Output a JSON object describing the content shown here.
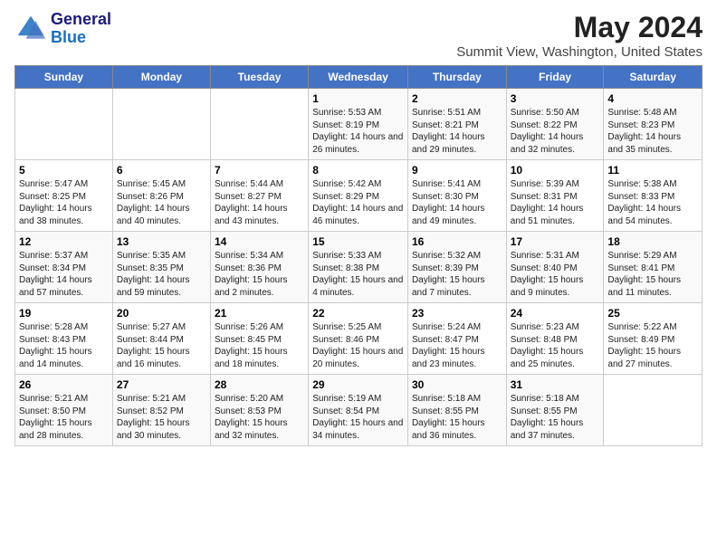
{
  "logo": {
    "line1": "General",
    "line2": "Blue"
  },
  "title": "May 2024",
  "subtitle": "Summit View, Washington, United States",
  "days_of_week": [
    "Sunday",
    "Monday",
    "Tuesday",
    "Wednesday",
    "Thursday",
    "Friday",
    "Saturday"
  ],
  "weeks": [
    [
      {
        "day": "",
        "info": ""
      },
      {
        "day": "",
        "info": ""
      },
      {
        "day": "",
        "info": ""
      },
      {
        "day": "1",
        "info": "Sunrise: 5:53 AM\nSunset: 8:19 PM\nDaylight: 14 hours and 26 minutes."
      },
      {
        "day": "2",
        "info": "Sunrise: 5:51 AM\nSunset: 8:21 PM\nDaylight: 14 hours and 29 minutes."
      },
      {
        "day": "3",
        "info": "Sunrise: 5:50 AM\nSunset: 8:22 PM\nDaylight: 14 hours and 32 minutes."
      },
      {
        "day": "4",
        "info": "Sunrise: 5:48 AM\nSunset: 8:23 PM\nDaylight: 14 hours and 35 minutes."
      }
    ],
    [
      {
        "day": "5",
        "info": "Sunrise: 5:47 AM\nSunset: 8:25 PM\nDaylight: 14 hours and 38 minutes."
      },
      {
        "day": "6",
        "info": "Sunrise: 5:45 AM\nSunset: 8:26 PM\nDaylight: 14 hours and 40 minutes."
      },
      {
        "day": "7",
        "info": "Sunrise: 5:44 AM\nSunset: 8:27 PM\nDaylight: 14 hours and 43 minutes."
      },
      {
        "day": "8",
        "info": "Sunrise: 5:42 AM\nSunset: 8:29 PM\nDaylight: 14 hours and 46 minutes."
      },
      {
        "day": "9",
        "info": "Sunrise: 5:41 AM\nSunset: 8:30 PM\nDaylight: 14 hours and 49 minutes."
      },
      {
        "day": "10",
        "info": "Sunrise: 5:39 AM\nSunset: 8:31 PM\nDaylight: 14 hours and 51 minutes."
      },
      {
        "day": "11",
        "info": "Sunrise: 5:38 AM\nSunset: 8:33 PM\nDaylight: 14 hours and 54 minutes."
      }
    ],
    [
      {
        "day": "12",
        "info": "Sunrise: 5:37 AM\nSunset: 8:34 PM\nDaylight: 14 hours and 57 minutes."
      },
      {
        "day": "13",
        "info": "Sunrise: 5:35 AM\nSunset: 8:35 PM\nDaylight: 14 hours and 59 minutes."
      },
      {
        "day": "14",
        "info": "Sunrise: 5:34 AM\nSunset: 8:36 PM\nDaylight: 15 hours and 2 minutes."
      },
      {
        "day": "15",
        "info": "Sunrise: 5:33 AM\nSunset: 8:38 PM\nDaylight: 15 hours and 4 minutes."
      },
      {
        "day": "16",
        "info": "Sunrise: 5:32 AM\nSunset: 8:39 PM\nDaylight: 15 hours and 7 minutes."
      },
      {
        "day": "17",
        "info": "Sunrise: 5:31 AM\nSunset: 8:40 PM\nDaylight: 15 hours and 9 minutes."
      },
      {
        "day": "18",
        "info": "Sunrise: 5:29 AM\nSunset: 8:41 PM\nDaylight: 15 hours and 11 minutes."
      }
    ],
    [
      {
        "day": "19",
        "info": "Sunrise: 5:28 AM\nSunset: 8:43 PM\nDaylight: 15 hours and 14 minutes."
      },
      {
        "day": "20",
        "info": "Sunrise: 5:27 AM\nSunset: 8:44 PM\nDaylight: 15 hours and 16 minutes."
      },
      {
        "day": "21",
        "info": "Sunrise: 5:26 AM\nSunset: 8:45 PM\nDaylight: 15 hours and 18 minutes."
      },
      {
        "day": "22",
        "info": "Sunrise: 5:25 AM\nSunset: 8:46 PM\nDaylight: 15 hours and 20 minutes."
      },
      {
        "day": "23",
        "info": "Sunrise: 5:24 AM\nSunset: 8:47 PM\nDaylight: 15 hours and 23 minutes."
      },
      {
        "day": "24",
        "info": "Sunrise: 5:23 AM\nSunset: 8:48 PM\nDaylight: 15 hours and 25 minutes."
      },
      {
        "day": "25",
        "info": "Sunrise: 5:22 AM\nSunset: 8:49 PM\nDaylight: 15 hours and 27 minutes."
      }
    ],
    [
      {
        "day": "26",
        "info": "Sunrise: 5:21 AM\nSunset: 8:50 PM\nDaylight: 15 hours and 28 minutes."
      },
      {
        "day": "27",
        "info": "Sunrise: 5:21 AM\nSunset: 8:52 PM\nDaylight: 15 hours and 30 minutes."
      },
      {
        "day": "28",
        "info": "Sunrise: 5:20 AM\nSunset: 8:53 PM\nDaylight: 15 hours and 32 minutes."
      },
      {
        "day": "29",
        "info": "Sunrise: 5:19 AM\nSunset: 8:54 PM\nDaylight: 15 hours and 34 minutes."
      },
      {
        "day": "30",
        "info": "Sunrise: 5:18 AM\nSunset: 8:55 PM\nDaylight: 15 hours and 36 minutes."
      },
      {
        "day": "31",
        "info": "Sunrise: 5:18 AM\nSunset: 8:55 PM\nDaylight: 15 hours and 37 minutes."
      },
      {
        "day": "",
        "info": ""
      }
    ]
  ]
}
